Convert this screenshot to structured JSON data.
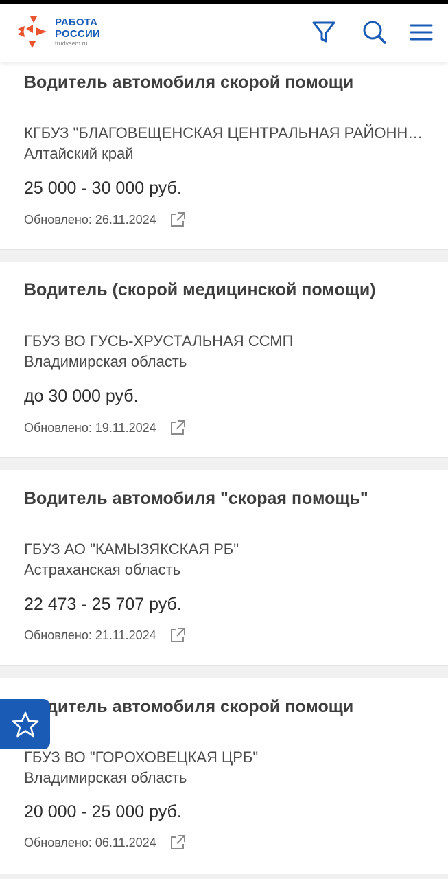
{
  "header": {
    "logo_line1": "РАБОТА",
    "logo_line2": "РОССИИ",
    "logo_site": "trudvsem.ru",
    "filter_icon": "filter-icon",
    "search_icon": "search-icon",
    "menu_icon": "hamburger-menu-icon"
  },
  "colors": {
    "brand_blue": "#1a5bb5",
    "logo_orange": "#e9532d",
    "background": "#f1f1f1",
    "card": "#ffffff"
  },
  "vacancies": [
    {
      "title": "Водитель автомобиля скорой помощи",
      "org": "КГБУЗ \"БЛАГОВЕЩЕНСКАЯ ЦЕНТРАЛЬНАЯ РАЙОННАЯ БОЛЬНИЦА\"",
      "region": "Алтайский край",
      "salary": "25 000 - 30 000 руб.",
      "updated": "Обновлено: 26.11.2024"
    },
    {
      "title": "Водитель (скорой медицинской помощи)",
      "org": "ГБУЗ ВО ГУСЬ-ХРУСТАЛЬНАЯ ССМП",
      "region": "Владимирская область",
      "salary": "до 30 000 руб.",
      "updated": "Обновлено: 19.11.2024"
    },
    {
      "title": "Водитель автомобиля \"скорая помощь\"",
      "org": "ГБУЗ АО \"КАМЫЗЯКСКАЯ РБ\"",
      "region": "Астраханская область",
      "salary": "22 473 - 25 707 руб.",
      "updated": "Обновлено: 21.11.2024"
    },
    {
      "title": "Водитель автомобиля скорой помощи",
      "org": "ГБУЗ ВО \"ГОРОХОВЕЦКАЯ ЦРБ\"",
      "region": "Владимирская область",
      "salary": "20 000 - 25 000 руб.",
      "updated": "Обновлено: 06.11.2024"
    }
  ],
  "favorite_button_icon": "star-outline-icon"
}
